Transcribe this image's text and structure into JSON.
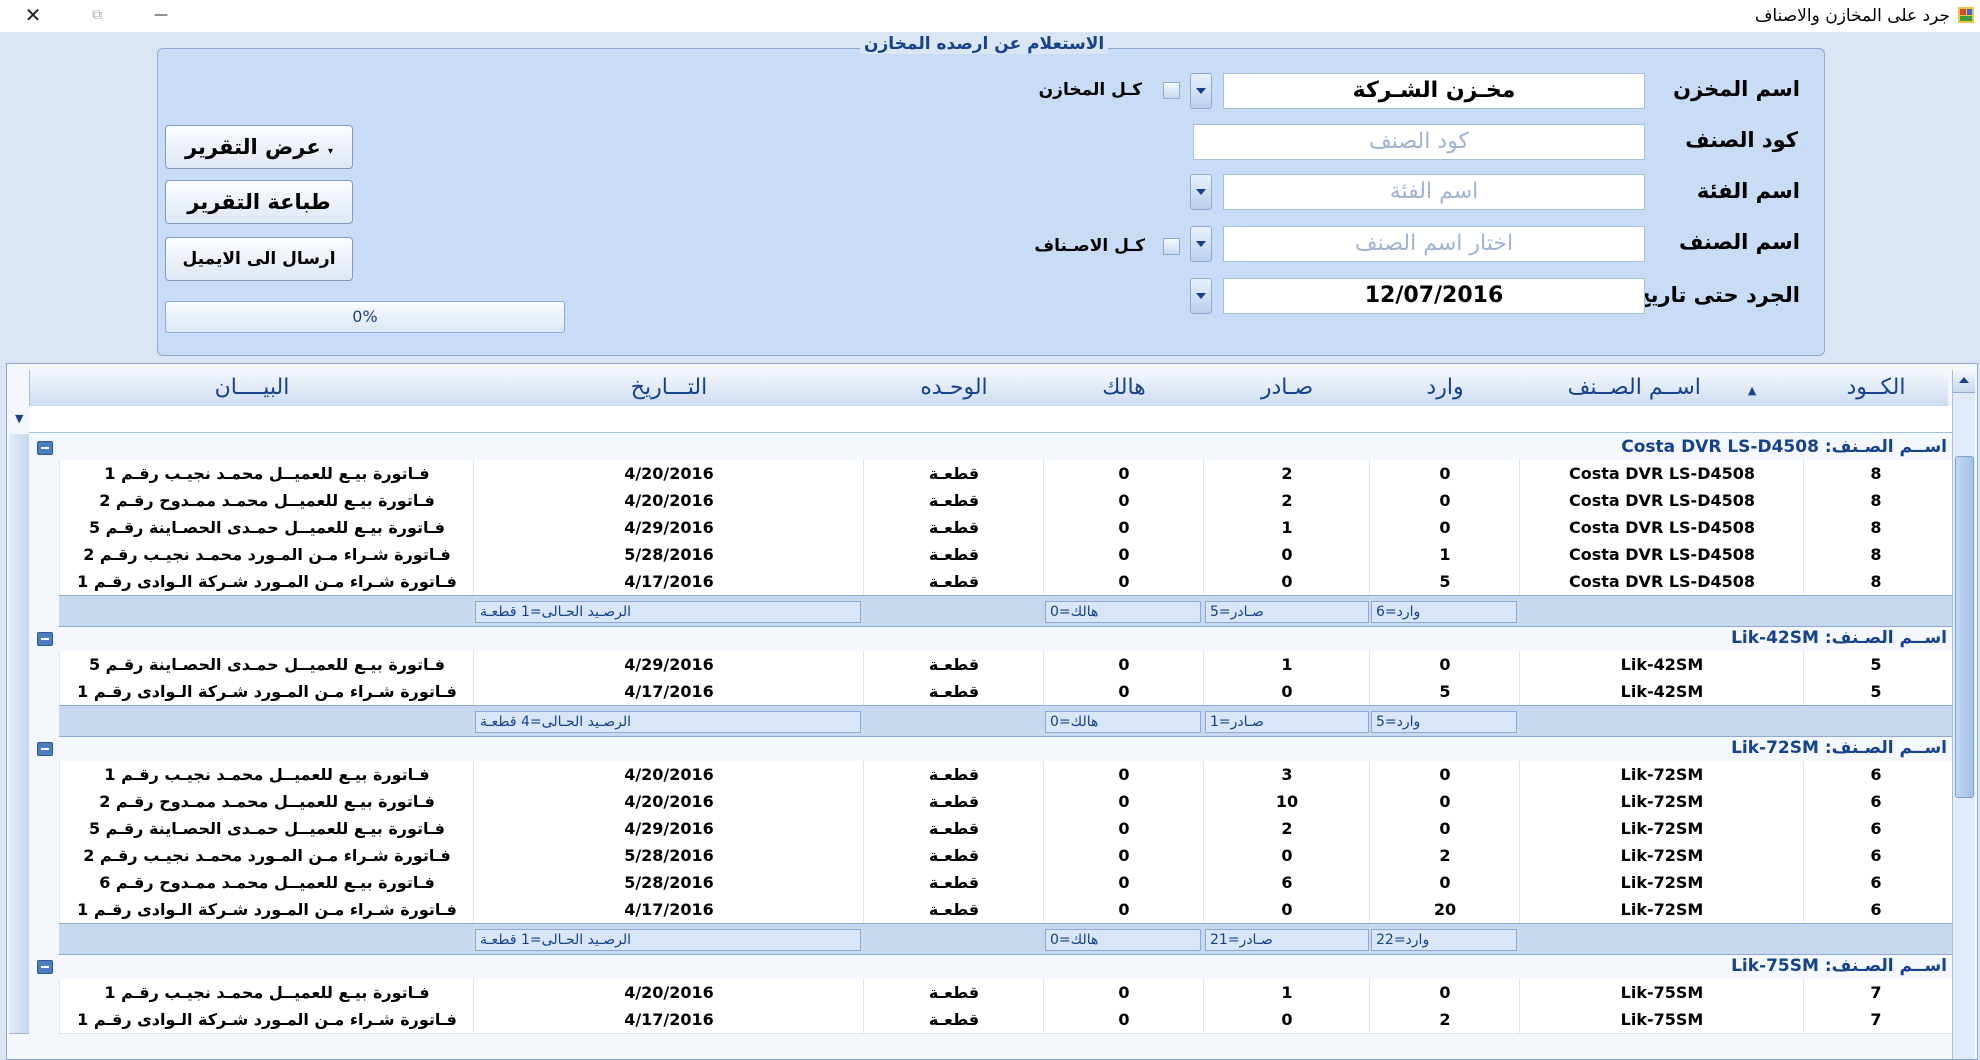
{
  "window": {
    "title": "جرد على المخازن والاصناف",
    "close": "✕",
    "restore": "⧉",
    "minimize": "—"
  },
  "query_panel": {
    "legend": "الاستعلام عن ارصده المخازن",
    "store_label": "اسم المخزن",
    "store_value": "مخـزن الشـركة",
    "all_stores_label": "كـل المخازن",
    "item_code_label": "كود الصنف",
    "item_code_placeholder": "كود الصنف",
    "category_label": "اسم الفئة",
    "category_placeholder": "اسم الفئة",
    "item_name_label": "اسم الصنف",
    "item_name_placeholder": "اختار اسم الصنف",
    "all_items_label": "كـل الاصـناف",
    "date_label": "الجرد حتى تاريخ",
    "date_value": "12/07/2016",
    "show_report": "عرض التقرير",
    "print_report": "طباعة التقرير",
    "send_email": "ارسال الى الايميل",
    "progress_text": "0%",
    "progress_value": 0
  },
  "grid": {
    "columns": {
      "code": "الكــود",
      "item_name": "اســم الصــنف",
      "in": "وارد",
      "out": "صـادر",
      "damaged": "هالك",
      "unit": "الوحـده",
      "date": "التـــاريخ",
      "statement": "البيــــان"
    },
    "groups": [
      {
        "header": "اســم الصـنف: Costa DVR LS-D4508",
        "rows": [
          {
            "code": "8",
            "item": "Costa DVR LS-D4508",
            "in": "0",
            "out": "2",
            "damaged": "0",
            "unit": "قطعـة",
            "date": "4/20/2016",
            "statement": "فـاتورة بيـع للعميــل محمـد نجيـب رقـم 1"
          },
          {
            "code": "8",
            "item": "Costa DVR LS-D4508",
            "in": "0",
            "out": "2",
            "damaged": "0",
            "unit": "قطعـة",
            "date": "4/20/2016",
            "statement": "فـاتورة بيـع للعميــل محمـد ممـدوح رقـم 2"
          },
          {
            "code": "8",
            "item": "Costa DVR LS-D4508",
            "in": "0",
            "out": "1",
            "damaged": "0",
            "unit": "قطعـة",
            "date": "4/29/2016",
            "statement": "فـاتورة بيـع للعميــل حمـدى الحصـاينة رقـم 5"
          },
          {
            "code": "8",
            "item": "Costa DVR LS-D4508",
            "in": "1",
            "out": "0",
            "damaged": "0",
            "unit": "قطعـة",
            "date": "5/28/2016",
            "statement": "فـاتورة شـراء مـن المـورد محمـد نجيـب رقـم 2"
          },
          {
            "code": "8",
            "item": "Costa DVR LS-D4508",
            "in": "5",
            "out": "0",
            "damaged": "0",
            "unit": "قطعـة",
            "date": "4/17/2016",
            "statement": "فـاتورة شـراء مـن المـورد شـركة الـوادى رقـم 1"
          }
        ],
        "summary": {
          "in": "وارد=6",
          "out": "صـادر=5",
          "damaged": "هالك=0",
          "balance": "الرصـيد الحـالى=1 قطعـة"
        }
      },
      {
        "header": "اســم الصـنف: Lik-42SM",
        "rows": [
          {
            "code": "5",
            "item": "Lik-42SM",
            "in": "0",
            "out": "1",
            "damaged": "0",
            "unit": "قطعـة",
            "date": "4/29/2016",
            "statement": "فـاتورة بيـع للعميــل حمـدى الحصـاينة رقـم 5"
          },
          {
            "code": "5",
            "item": "Lik-42SM",
            "in": "5",
            "out": "0",
            "damaged": "0",
            "unit": "قطعـة",
            "date": "4/17/2016",
            "statement": "فـاتورة شـراء مـن المـورد شـركة الـوادى رقـم 1"
          }
        ],
        "summary": {
          "in": "وارد=5",
          "out": "صـادر=1",
          "damaged": "هالك=0",
          "balance": "الرصـيد الحـالى=4 قطعـة"
        }
      },
      {
        "header": "اســم الصـنف: Lik-72SM",
        "rows": [
          {
            "code": "6",
            "item": "Lik-72SM",
            "in": "0",
            "out": "3",
            "damaged": "0",
            "unit": "قطعـة",
            "date": "4/20/2016",
            "statement": "فـاتورة بيـع للعميــل محمـد نجيـب رقـم 1"
          },
          {
            "code": "6",
            "item": "Lik-72SM",
            "in": "0",
            "out": "10",
            "damaged": "0",
            "unit": "قطعـة",
            "date": "4/20/2016",
            "statement": "فـاتورة بيـع للعميــل محمـد ممـدوح رقـم 2"
          },
          {
            "code": "6",
            "item": "Lik-72SM",
            "in": "0",
            "out": "2",
            "damaged": "0",
            "unit": "قطعـة",
            "date": "4/29/2016",
            "statement": "فـاتورة بيـع للعميــل حمـدى الحصـاينة رقـم 5"
          },
          {
            "code": "6",
            "item": "Lik-72SM",
            "in": "2",
            "out": "0",
            "damaged": "0",
            "unit": "قطعـة",
            "date": "5/28/2016",
            "statement": "فـاتورة شـراء مـن المـورد محمـد نجيـب رقـم 2"
          },
          {
            "code": "6",
            "item": "Lik-72SM",
            "in": "0",
            "out": "6",
            "damaged": "0",
            "unit": "قطعـة",
            "date": "5/28/2016",
            "statement": "فـاتورة بيـع للعميــل محمـد ممـدوح رقـم 6"
          },
          {
            "code": "6",
            "item": "Lik-72SM",
            "in": "20",
            "out": "0",
            "damaged": "0",
            "unit": "قطعـة",
            "date": "4/17/2016",
            "statement": "فـاتورة شـراء مـن المـورد شـركة الـوادى رقـم 1"
          }
        ],
        "summary": {
          "in": "وارد=22",
          "out": "صـادر=21",
          "damaged": "هالك=0",
          "balance": "الرصـيد الحـالى=1 قطعـة"
        }
      },
      {
        "header": "اســم الصـنف: Lik-75SM",
        "rows": [
          {
            "code": "7",
            "item": "Lik-75SM",
            "in": "0",
            "out": "1",
            "damaged": "0",
            "unit": "قطعـة",
            "date": "4/20/2016",
            "statement": "فـاتورة بيـع للعميــل محمـد نجيـب رقـم 1"
          },
          {
            "code": "7",
            "item": "Lik-75SM",
            "in": "2",
            "out": "0",
            "damaged": "0",
            "unit": "قطعـة",
            "date": "4/17/2016",
            "statement": "فـاتورة شـراء مـن المـورد شـركة الـوادى رقـم 1"
          }
        ]
      }
    ]
  }
}
